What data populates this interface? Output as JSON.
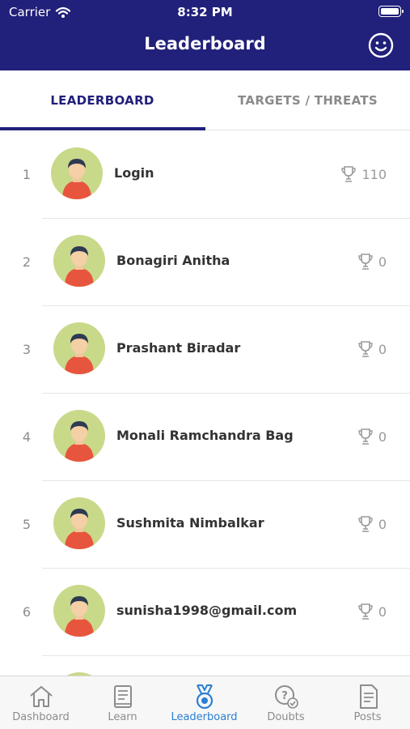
{
  "status_bar": {
    "carrier": "Carrier",
    "time": "8:32 PM"
  },
  "header": {
    "title": "Leaderboard"
  },
  "tabs": [
    {
      "label": "LEADERBOARD",
      "active": true
    },
    {
      "label": "TARGETS / THREATS",
      "active": false
    }
  ],
  "leaderboard": [
    {
      "rank": "1",
      "name": "Login",
      "score": "110"
    },
    {
      "rank": "2",
      "name": "Bonagiri Anitha",
      "score": "0"
    },
    {
      "rank": "3",
      "name": "Prashant Biradar",
      "score": "0"
    },
    {
      "rank": "4",
      "name": "Monali Ramchandra Bag",
      "score": "0"
    },
    {
      "rank": "5",
      "name": "Sushmita Nimbalkar",
      "score": "0"
    },
    {
      "rank": "6",
      "name": "sunisha1998@gmail.com",
      "score": "0"
    }
  ],
  "bottom_nav": [
    {
      "label": "Dashboard",
      "icon": "home-icon"
    },
    {
      "label": "Learn",
      "icon": "book-icon"
    },
    {
      "label": "Leaderboard",
      "icon": "medal-icon",
      "active": true
    },
    {
      "label": "Doubts",
      "icon": "question-icon"
    },
    {
      "label": "Posts",
      "icon": "document-icon"
    }
  ],
  "colors": {
    "header": "#21207a",
    "active_tab": "#21207a",
    "nav_active": "#2a7fd5",
    "avatar_bg": "#c9d98a"
  }
}
